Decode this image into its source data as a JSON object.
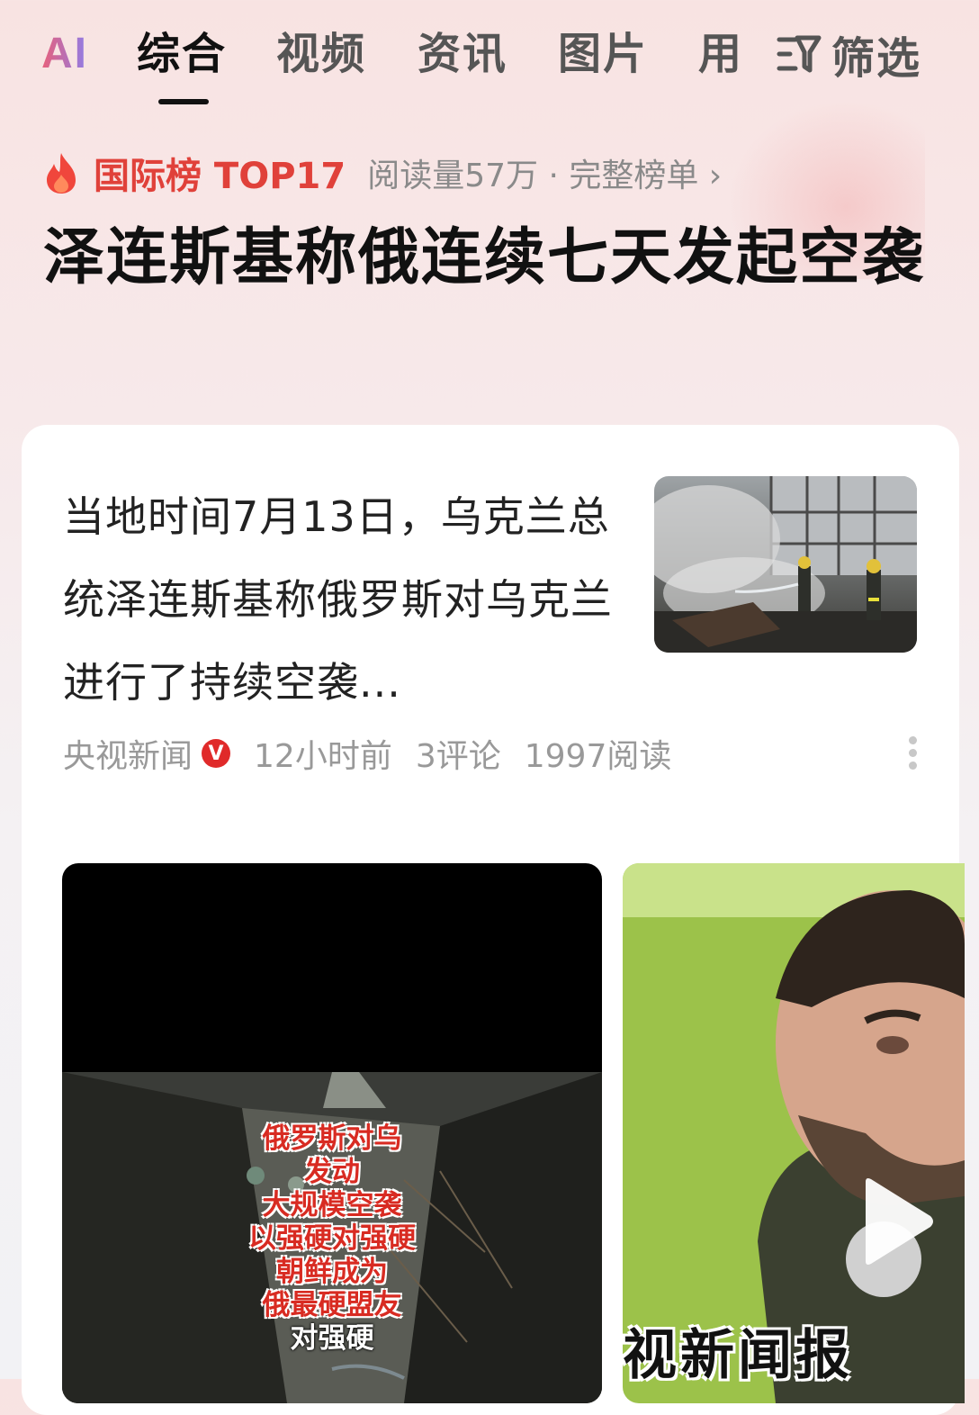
{
  "tabs": {
    "ai": "AI",
    "items": [
      "综合",
      "视频",
      "资讯",
      "图片",
      "用"
    ],
    "active_index": 0,
    "filter_label": "筛选"
  },
  "ranking": {
    "label": "国际榜 TOP17",
    "meta": "阅读量57万 · 完整榜单 ›",
    "accent_color": "#e0413a"
  },
  "headline": "泽连斯基称俄连续七天发起空袭",
  "article": {
    "summary": "当地时间7月13日，乌克兰总统泽连斯基称俄罗斯对乌克兰进行了持续空袭...",
    "source": "央视新闻",
    "verified_badge": "V",
    "time": "12小时前",
    "comments": "3评论",
    "reads": "1997阅读"
  },
  "videos": [
    {
      "caption_lines": [
        "俄罗斯对乌",
        "发动",
        "大规模空袭",
        "以强硬对强硬",
        "朝鲜成为",
        "俄最硬盟友"
      ],
      "caption_white": "对强硬"
    },
    {
      "overlay_text": "视新闻报"
    }
  ]
}
